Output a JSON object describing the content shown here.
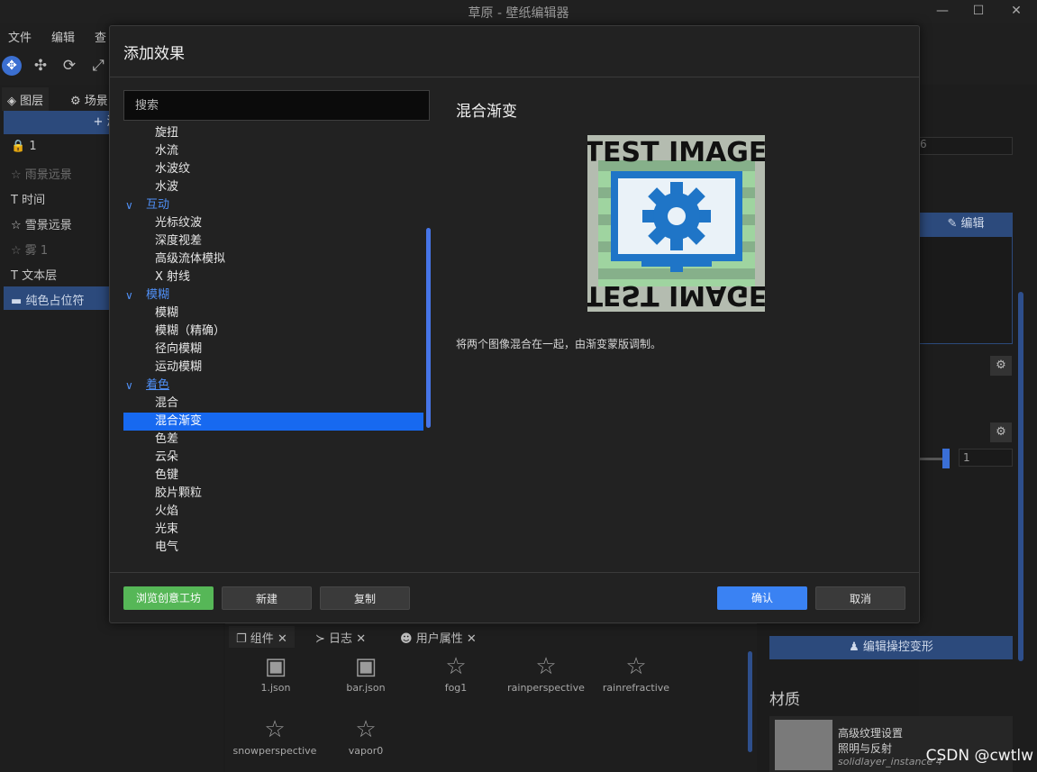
{
  "window": {
    "title": "草原 - 壁纸编辑器",
    "minimize": "—",
    "maximize": "☐",
    "close": "✕"
  },
  "menu": [
    "文件",
    "编辑",
    "查"
  ],
  "left_panel": {
    "tabs": [
      "图层",
      "场景"
    ],
    "add_button": "+ 添加",
    "layers": [
      "1",
      "雨景远景",
      "时间",
      "雪景远景",
      "雾 1",
      "文本层",
      "纯色占位符"
    ]
  },
  "dialog": {
    "title": "添加效果",
    "search_placeholder": "搜索",
    "tree": [
      {
        "label": "旋扭",
        "type": "item"
      },
      {
        "label": "水流",
        "type": "item"
      },
      {
        "label": "水波纹",
        "type": "item"
      },
      {
        "label": "水波",
        "type": "item"
      },
      {
        "label": "互动",
        "type": "category"
      },
      {
        "label": "光标纹波",
        "type": "item"
      },
      {
        "label": "深度视差",
        "type": "item"
      },
      {
        "label": "高级流体模拟",
        "type": "item"
      },
      {
        "label": "X 射线",
        "type": "item"
      },
      {
        "label": "模糊",
        "type": "category"
      },
      {
        "label": "模糊",
        "type": "item"
      },
      {
        "label": "模糊（精确）",
        "type": "item"
      },
      {
        "label": "径向模糊",
        "type": "item"
      },
      {
        "label": "运动模糊",
        "type": "item"
      },
      {
        "label": "着色",
        "type": "category"
      },
      {
        "label": "混合",
        "type": "item"
      },
      {
        "label": "混合渐变",
        "type": "item",
        "selected": true
      },
      {
        "label": "色差",
        "type": "item"
      },
      {
        "label": "云朵",
        "type": "item"
      },
      {
        "label": "色键",
        "type": "item"
      },
      {
        "label": "胶片颗粒",
        "type": "item"
      },
      {
        "label": "火焰",
        "type": "item"
      },
      {
        "label": "光束",
        "type": "item"
      },
      {
        "label": "电气",
        "type": "item"
      }
    ],
    "preview": {
      "title": "混合渐变",
      "image_text_top": "TEST IMAGE",
      "image_text_bottom": "TEST IMAGE",
      "description": "将两个图像混合在一起，由渐变蒙版调制。"
    },
    "buttons": {
      "workshop": "浏览创意工坊",
      "new": "新建",
      "copy": "复制",
      "confirm": "确认",
      "cancel": "取消"
    }
  },
  "bottom_panel": {
    "tabs": [
      "组件",
      "日志",
      "用户属性"
    ],
    "components": [
      "1.json",
      "bar.json",
      "fog1",
      "rainperspective",
      "rainrefractive",
      "snowperspective",
      "vapor0"
    ]
  },
  "right_panel": {
    "edit_button": "编辑",
    "input_value": "6",
    "slider_value": "1",
    "transform_button": "编辑操控变形",
    "material_heading": "材质",
    "material_lines": [
      "高级纹理设置",
      "照明与反射",
      "solidlayer_instance 4"
    ]
  },
  "watermark": "CSDN @cwtlw",
  "colors": {
    "accent": "#1769f0",
    "category": "#4f8ff5",
    "green": "#56b757",
    "confirm": "#3a82f3"
  }
}
